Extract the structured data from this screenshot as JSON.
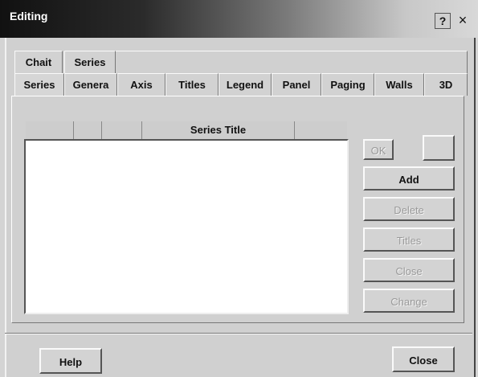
{
  "window": {
    "title": "Editing",
    "help_glyph": "?",
    "close_glyph": "×"
  },
  "tabs_top": [
    {
      "label": "Chait"
    },
    {
      "label": "Series"
    }
  ],
  "tabs_bottom": [
    {
      "label": "Series"
    },
    {
      "label": "Genera"
    },
    {
      "label": "Axis"
    },
    {
      "label": "Titles"
    },
    {
      "label": "Legend"
    },
    {
      "label": "Panel"
    },
    {
      "label": "Paging"
    },
    {
      "label": "Walls"
    },
    {
      "label": "3D"
    }
  ],
  "series_list": {
    "column_header": "Series Title",
    "rows": []
  },
  "buttons": {
    "ok": "OK",
    "blank": "",
    "add": "Add",
    "delete": "Delete",
    "titles": "Titles",
    "close_inner": "Close",
    "change": "Change"
  },
  "footer": {
    "help": "Help",
    "close": "Close"
  }
}
